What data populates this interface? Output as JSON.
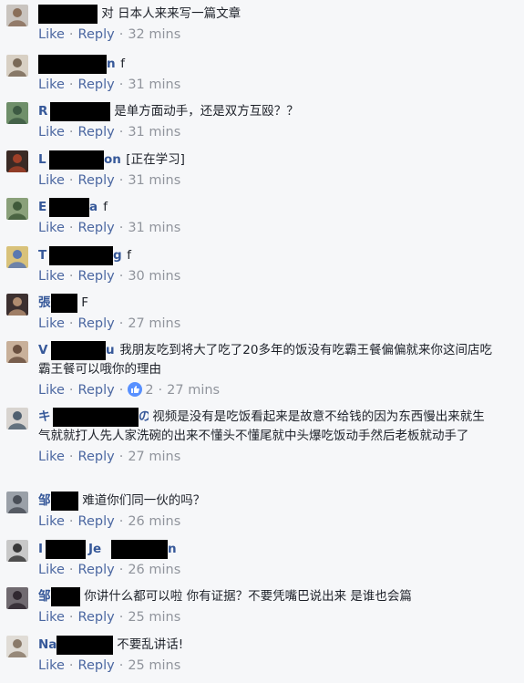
{
  "ui": {
    "like": "Like",
    "reply": "Reply",
    "sep": "·"
  },
  "colors": {
    "link": "#4b67a1",
    "name": "#365899",
    "muted": "#90949c",
    "reaction": "#5890ff"
  },
  "comments": [
    {
      "name_prefix": "",
      "name_suffix": "",
      "text": "对 日本人来来写一篇文章",
      "time": "32 mins",
      "avatar_icon": "person-icon"
    },
    {
      "name_prefix": "",
      "name_suffix": "n",
      "text": "f",
      "time": "31 mins",
      "avatar_icon": "person-icon"
    },
    {
      "name_prefix": "R",
      "name_suffix": "",
      "text": "是单方面动手，还是双方互殴？？",
      "time": "31 mins",
      "avatar_icon": "landscape-icon"
    },
    {
      "name_prefix": "L",
      "name_suffix": "on",
      "text": "[正在学习]",
      "time": "31 mins",
      "avatar_icon": "mask-icon"
    },
    {
      "name_prefix": "E",
      "name_suffix": "a",
      "text": "f",
      "time": "31 mins",
      "avatar_icon": "person-icon"
    },
    {
      "name_prefix": "T",
      "name_suffix": "g",
      "text": "f",
      "time": "30 mins",
      "avatar_icon": "cartoon-icon"
    },
    {
      "name_prefix": "張",
      "name_suffix": "",
      "text": "F",
      "time": "27 mins",
      "avatar_icon": "person-icon"
    },
    {
      "name_prefix": "V",
      "name_suffix": "u",
      "text": "我朋友吃到将大了吃了20多年的饭没有吃霸王餐偏偏就来你这间店吃霸王餐可以哦你的理由",
      "time": "27 mins",
      "avatar_icon": "person-icon",
      "reactions": "2"
    },
    {
      "name_prefix": "キ",
      "name_suffix": "の",
      "text": "视频是没有是吃饭看起来是故意不给钱的因为东西慢出来就生气就就打人先人家洗碗的出来不懂头不懂尾就中头爆吃饭动手然后老板就动手了",
      "time": "27 mins",
      "avatar_icon": "person-icon"
    },
    {
      "name_prefix": "邹",
      "name_suffix": "",
      "text": "难道你们同一伙的吗？",
      "time": "26 mins",
      "avatar_icon": "person-icon"
    },
    {
      "name_prefix": "I",
      "name_suffix": "n",
      "name_mid": "Je",
      "text": "",
      "time": "26 mins",
      "avatar_icon": "person-icon"
    },
    {
      "name_prefix": "邹",
      "name_suffix": "",
      "text": "你讲什么都可以啦 你有证据？不要凭嘴巴说出来 是谁也会篇",
      "time": "25 mins",
      "avatar_icon": "person-icon"
    },
    {
      "name_prefix": "Na",
      "name_suffix": "",
      "text": "不要乱讲话!",
      "time": "25 mins",
      "avatar_icon": "person-icon"
    }
  ]
}
